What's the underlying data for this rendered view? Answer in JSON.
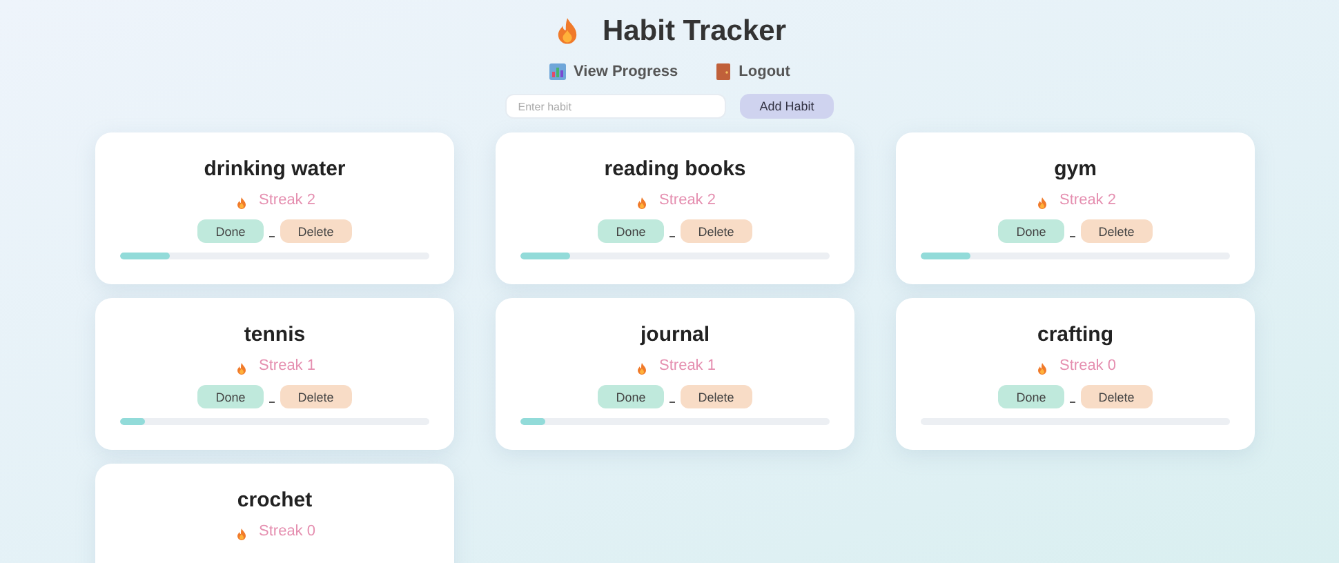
{
  "header": {
    "title": "Habit Tracker",
    "links": [
      {
        "label": "View Progress"
      },
      {
        "label": "Logout"
      }
    ]
  },
  "form": {
    "placeholder": "Enter habit",
    "button": "Add Habit"
  },
  "habits": [
    {
      "name": "drinking water",
      "streak": "Streak 2",
      "done": "Done",
      "delete": "Delete",
      "level": 0.16
    },
    {
      "name": "reading books",
      "streak": "Streak 2",
      "done": "Done",
      "delete": "Delete",
      "level": 0.16
    },
    {
      "name": "gym",
      "streak": "Streak 2",
      "done": "Done",
      "delete": "Delete",
      "level": 0.16
    },
    {
      "name": "tennis",
      "streak": "Streak 1",
      "done": "Done",
      "delete": "Delete",
      "level": 0.08
    },
    {
      "name": "journal",
      "streak": "Streak 1",
      "done": "Done",
      "delete": "Delete",
      "level": 0.08
    },
    {
      "name": "crafting",
      "streak": "Streak 0",
      "done": "Done",
      "delete": "Delete",
      "level": 0
    },
    {
      "name": "crochet",
      "streak": "Streak 0"
    }
  ]
}
